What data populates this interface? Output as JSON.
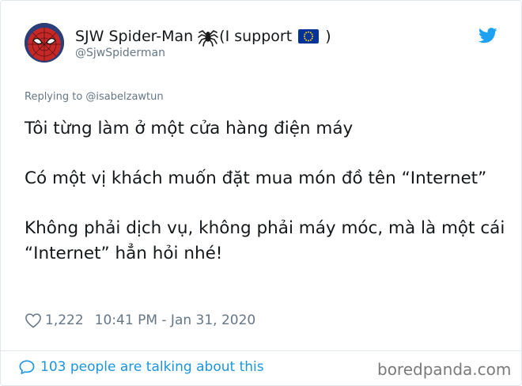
{
  "user": {
    "display_name": "SJW Spider-Man",
    "name_suffix_open": "(I support",
    "name_suffix_close": ")",
    "handle": "@SjwSpiderman"
  },
  "reply": {
    "text": "Replying to @isabelzawtun"
  },
  "tweet": {
    "paragraphs": [
      "Tôi từng làm ở một cửa hàng điện máy",
      "Có một vị khách muốn đặt mua món đồ tên “Internet”",
      "Không phải dịch vụ, không phải máy móc, mà là một cái “Internet” hẳn hỏi nhé!"
    ]
  },
  "meta": {
    "likes": "1,222",
    "timestamp": "10:41 PM - Jan 31, 2020"
  },
  "footer": {
    "talking": "103 people are talking about this",
    "watermark": "boredpanda.com"
  },
  "icons": {
    "avatar": "spiderman-avatar",
    "spider": "spider-emoji",
    "flag": "eu-flag-emoji",
    "logo": "twitter-bird-icon",
    "like": "heart-icon",
    "comment": "speech-bubble-icon"
  },
  "colors": {
    "link_blue": "#1b95e0",
    "twitter_blue": "#1da1f2",
    "muted": "#657786",
    "text": "#14171a",
    "eu_blue": "#003399",
    "eu_star": "#ffcc00"
  }
}
